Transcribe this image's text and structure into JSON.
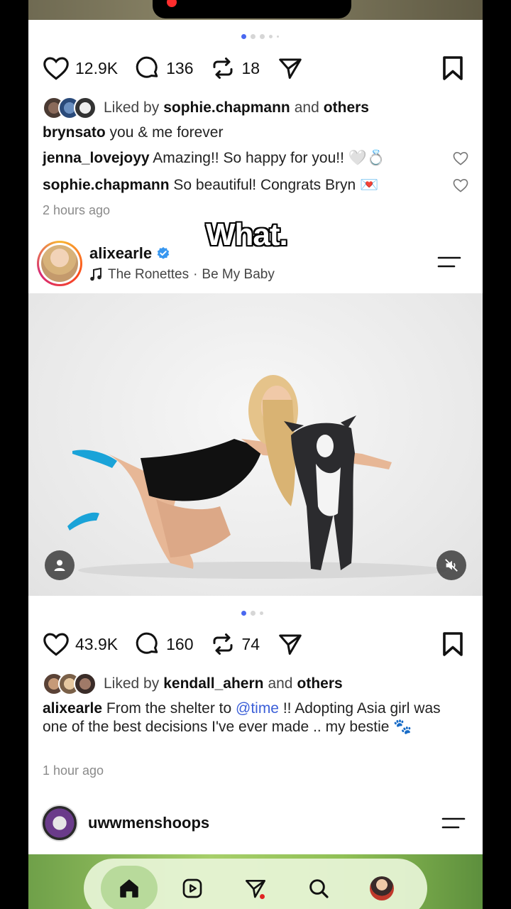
{
  "overlay_caption": "What.",
  "post1": {
    "likes": "12.9K",
    "comments": "136",
    "reposts": "18",
    "liked_by_prefix": "Liked by",
    "liked_by_user": "sophie.chapmann",
    "liked_by_and": "and",
    "liked_by_others": "others",
    "caption_user": "brynsato",
    "caption_text": "you & me forever",
    "comments_list": [
      {
        "user": "jenna_lovejoyy",
        "text": "Amazing!! So happy for you!! 🤍💍"
      },
      {
        "user": "sophie.chapmann",
        "text": "So beautiful! Congrats Bryn 💌"
      }
    ],
    "time_ago": "2 hours ago"
  },
  "post2": {
    "username": "alixearle",
    "music_artist": "The Ronettes",
    "music_sep": "·",
    "music_song": "Be My Baby",
    "likes": "43.9K",
    "comments": "160",
    "reposts": "74",
    "liked_by_prefix": "Liked by",
    "liked_by_user": "kendall_ahern",
    "liked_by_and": "and",
    "liked_by_others": "others",
    "caption_user": "alixearle",
    "caption_text_1": "From the shelter to",
    "caption_mention": "@time",
    "caption_text_2": "!! Adopting Asia girl was one of the best decisions I've ever made .. my bestie 🐾",
    "time_ago": "1 hour ago"
  },
  "post3": {
    "username": "uwwmenshoops"
  },
  "colors": {
    "accent": "#4a68f0",
    "verified": "#3897f0",
    "mention": "#3b5fd8",
    "notification": "#e02424"
  },
  "icons": [
    "heart-icon",
    "comment-icon",
    "repost-icon",
    "share-icon",
    "bookmark-icon",
    "music-note-icon",
    "verified-icon",
    "menu-icon",
    "user-tag-icon",
    "mute-icon",
    "home-icon",
    "reels-icon",
    "send-icon",
    "search-icon"
  ]
}
